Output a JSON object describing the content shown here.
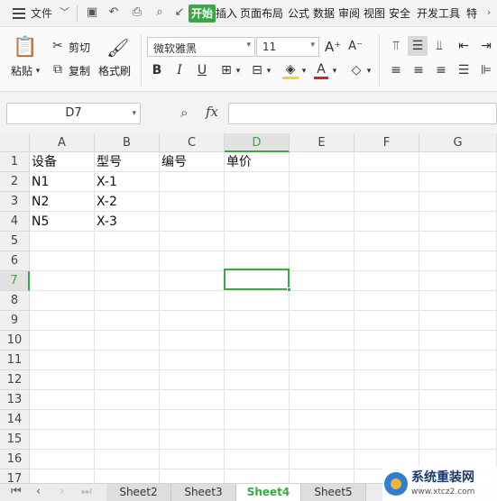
{
  "menubar": {
    "file_label": "文件",
    "tabs": [
      "开始",
      "插入",
      "页面布局",
      "公式",
      "数据",
      "审阅",
      "视图",
      "安全",
      "开发工具",
      "特"
    ],
    "active_tab": "开始",
    "accent_color": "#3aa844"
  },
  "ribbon": {
    "paste_label": "粘贴",
    "cut_label": "剪切",
    "copy_label": "复制",
    "format_painter_label": "格式刷",
    "font_name": "微软雅黑",
    "font_size": "11",
    "bold": "B",
    "italic": "I",
    "underline": "U",
    "font_color_glyph": "A"
  },
  "formula_bar": {
    "name_box": "D7",
    "fx_label": "fx",
    "formula": ""
  },
  "sheet": {
    "columns": [
      "A",
      "B",
      "C",
      "D",
      "E",
      "F",
      "G"
    ],
    "rows": [
      "1",
      "2",
      "3",
      "4",
      "5",
      "6",
      "7",
      "8",
      "9",
      "10",
      "11",
      "12",
      "13",
      "14",
      "15",
      "16",
      "17"
    ],
    "selected_column": "D",
    "selected_row": "7",
    "cells": {
      "A1": "设备",
      "B1": "型号",
      "C1": "编号",
      "D1": "单价",
      "A2": "N1",
      "B2": "X-1",
      "A3": "N2",
      "B3": "X-2",
      "A4": "N5",
      "B4": "X-3"
    }
  },
  "sheet_tabs": {
    "tabs": [
      "Sheet2",
      "Sheet3",
      "Sheet4",
      "Sheet5"
    ],
    "active": "Sheet4"
  },
  "watermark": {
    "title": "系统重装网",
    "url": "www.xtcz2.com"
  }
}
